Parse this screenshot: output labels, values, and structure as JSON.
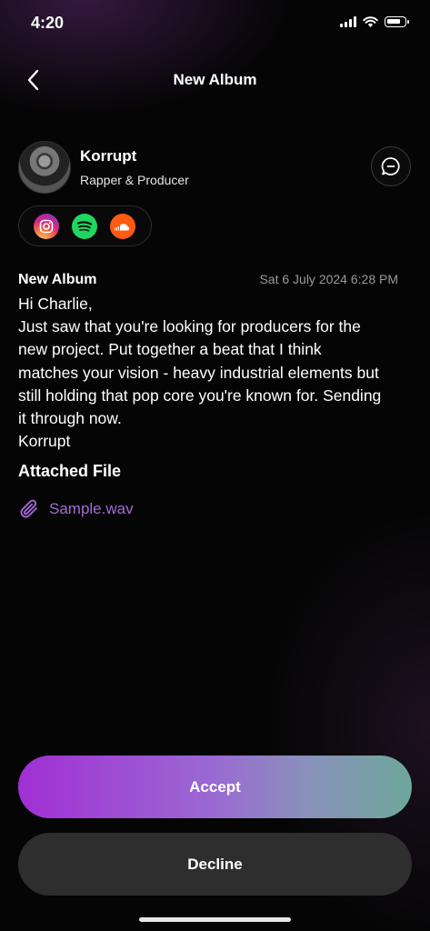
{
  "status_bar": {
    "time": "4:20"
  },
  "header": {
    "title": "New Album"
  },
  "artist": {
    "name": "Korrupt",
    "role": "Rapper & Producer"
  },
  "socials": [
    "instagram-icon",
    "spotify-icon",
    "soundcloud-icon"
  ],
  "message": {
    "subject": "New Album",
    "date": "Sat 6 July 2024 6:28 PM",
    "lines": [
      "Hi Charlie,",
      "Just saw that you're looking for producers for the",
      "new project. Put together a beat that I think",
      "matches your vision - heavy industrial elements but",
      "still holding that pop core you're known for. Sending",
      "it through now.",
      "Korrupt"
    ],
    "attached_label": "Attached File",
    "attachment": "Sample.wav"
  },
  "actions": {
    "accept": "Accept",
    "decline": "Decline"
  },
  "colors": {
    "attachment": "#a66ad6",
    "accept_gradient_start": "#a12fd4",
    "accept_gradient_end": "#6ea79a",
    "decline_bg": "#2e2e2e"
  }
}
